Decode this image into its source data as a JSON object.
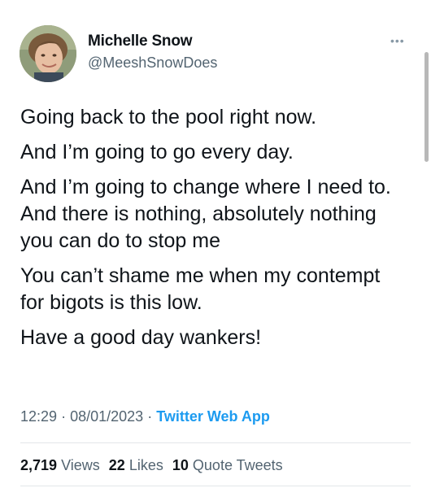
{
  "author": {
    "name": "Michelle Snow",
    "handle": "@MeeshSnowDoes"
  },
  "menu_icon": "more-horizontal-icon",
  "tweet": {
    "paragraphs": [
      "Going back to the pool right now.",
      "And I’m going to go every day.",
      "And I’m going to change where I need to. And there is nothing, absolutely nothing you can do to stop me",
      "You can’t shame me when my contempt for bigots is this low.",
      "Have a good day wankers!"
    ],
    "time": "12:29",
    "separator": "·",
    "date": "08/01/2023",
    "source": "Twitter Web App"
  },
  "stats": {
    "views_count": "2,719",
    "views_label": "Views",
    "likes_count": "22",
    "likes_label": "Likes",
    "quotes_count": "10",
    "quotes_label": "Quote Tweets"
  },
  "colors": {
    "link": "#1d9bf0",
    "secondary_text": "#536471",
    "primary_text": "#0f1419"
  }
}
